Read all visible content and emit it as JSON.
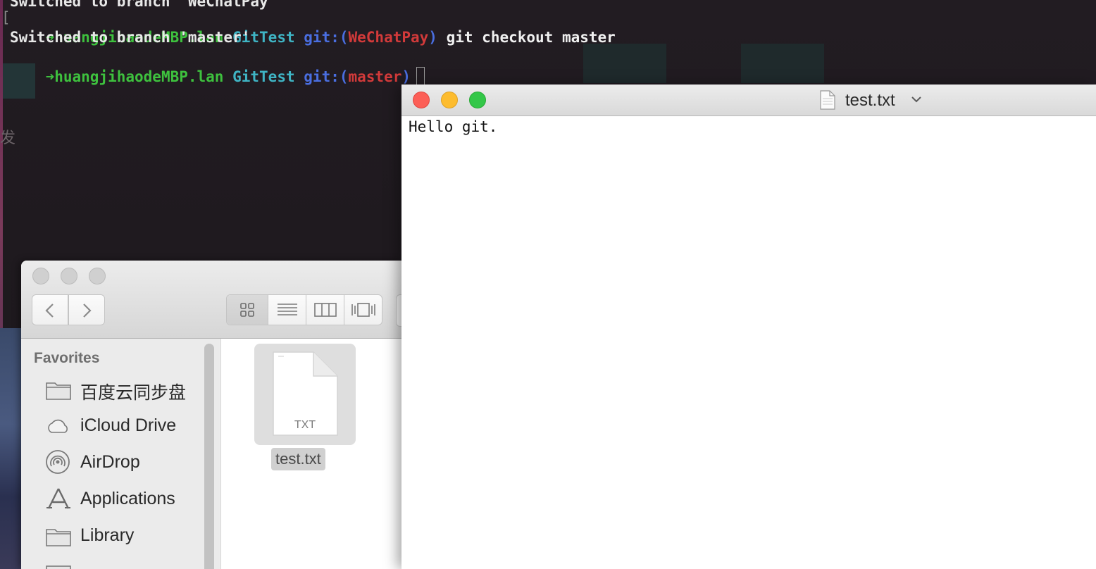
{
  "terminal": {
    "line0": "Switched to branch 'WeChatPay'",
    "line1": {
      "arrow": "➜",
      "host": "huangjihaodeMBP.lan",
      "dir": "GitTest",
      "git_prefix": "git:(",
      "branch": "WeChatPay",
      "git_suffix": ")",
      "command": "git checkout master"
    },
    "line2": "Switched to branch 'master'",
    "line3": {
      "arrow": "➜",
      "host": "huangjihaodeMBP.lan",
      "dir": "GitTest",
      "git_prefix": "git:(",
      "branch": "master",
      "git_suffix": ")"
    },
    "bracket": "[",
    "colors": {
      "prompt": "#3ec13e",
      "dir": "#3fb4c4",
      "git": "#4a6ee0",
      "branch": "#d23a3a"
    }
  },
  "background": {
    "partial_char": "发"
  },
  "textedit": {
    "title": "test.txt",
    "title_icon": "document-icon",
    "menu_icon": "chevron-down-icon",
    "content": "Hello git."
  },
  "finder": {
    "view_modes": [
      "icon-view-icon",
      "list-view-icon",
      "column-view-icon",
      "cover-flow-icon"
    ],
    "active_view": "icon",
    "sidebar": {
      "heading": "Favorites",
      "items": [
        {
          "label": "百度云同步盘",
          "icon": "folder-icon"
        },
        {
          "label": "iCloud Drive",
          "icon": "cloud-icon"
        },
        {
          "label": "AirDrop",
          "icon": "airdrop-icon"
        },
        {
          "label": "Applications",
          "icon": "applications-icon"
        },
        {
          "label": "Library",
          "icon": "folder-icon"
        }
      ]
    },
    "files": [
      {
        "name": "test.txt",
        "ext": "TXT",
        "selected": true
      }
    ]
  }
}
